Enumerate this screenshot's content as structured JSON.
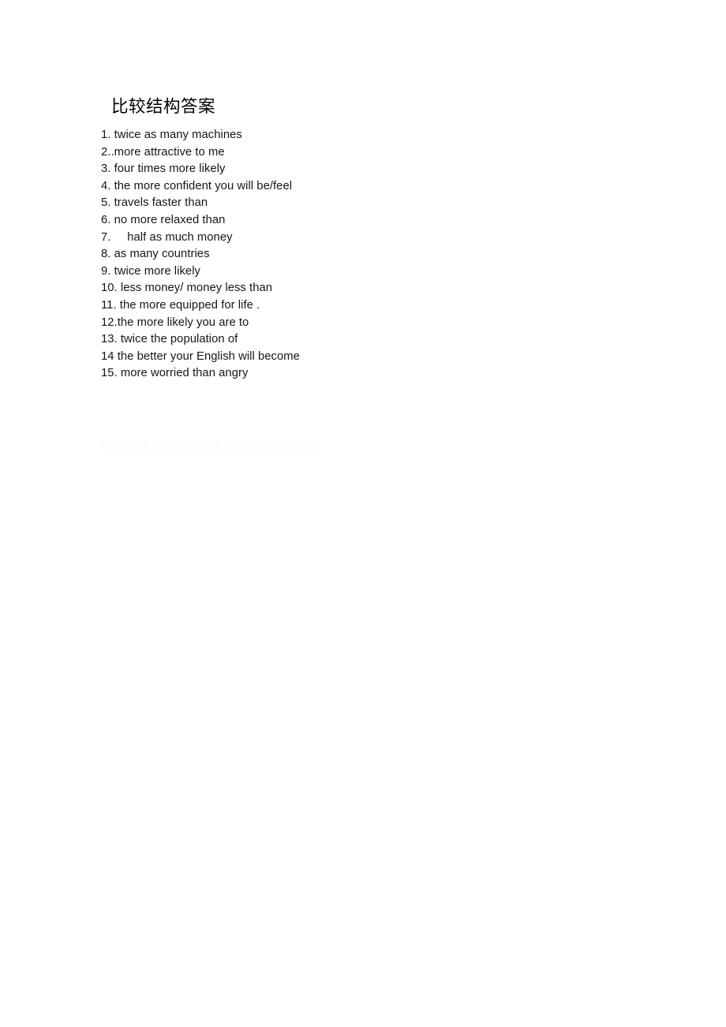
{
  "document": {
    "title": "比较结构答案",
    "background_color": "#ffffff",
    "text_color": "#161616",
    "answers": [
      "1. twice as many machines",
      "2..more attractive to me",
      "3. four times more likely",
      "4. the more confident you will be/feel",
      "5. travels faster than",
      "6. no more relaxed than",
      "7.     half as much money",
      "8. as many countries",
      "9. twice more likely",
      "10. less money/ money less than",
      "11. the more equipped for life .",
      "12.the more likely you are to",
      "13. twice the population of",
      "14 the better your English will become",
      "15. more worried than angry"
    ]
  }
}
